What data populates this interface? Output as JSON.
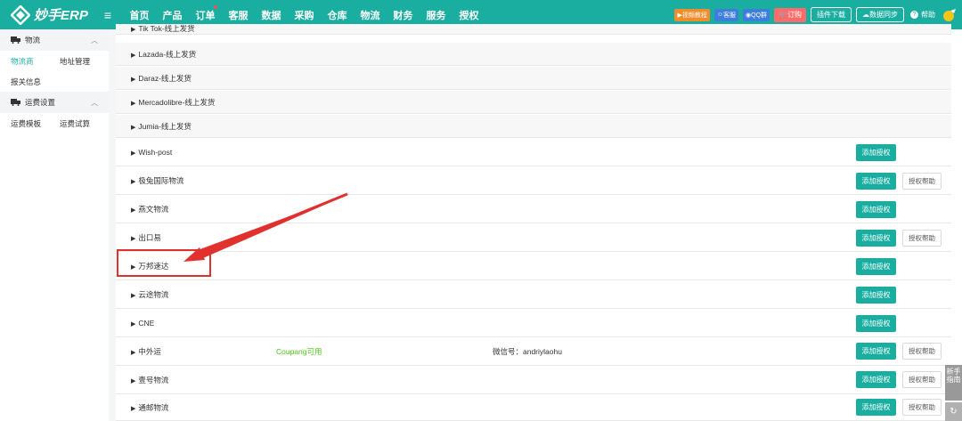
{
  "app": {
    "brand": "妙手ERP",
    "menu_icon": "hamburger-icon"
  },
  "nav": [
    "首页",
    "产品",
    "订单",
    "客服",
    "数据",
    "采购",
    "仓库",
    "物流",
    "财务",
    "服务",
    "授权"
  ],
  "tools": {
    "video_tutorial": "视频教程",
    "customer_service": "客服",
    "qq_group": "QQ群",
    "subscribe": "订购",
    "plugin_download": "插件下载",
    "data_sync": "数据同步",
    "help": "帮助"
  },
  "colors": {
    "brand": "#1aaea0",
    "highlight": "#e0312f"
  },
  "sidebar": {
    "logistics_group": "物流",
    "logistics_items": [
      "物流商",
      "地址管理"
    ],
    "customs": "报关信息",
    "freight_group": "运费设置",
    "freight_items": [
      "运费模板",
      "运费试算"
    ]
  },
  "rows": [
    {
      "name": "Tik Tok-线上发货",
      "add": null,
      "help": null,
      "note": null
    },
    {
      "name": "Lazada-线上发货",
      "add": null,
      "help": null,
      "note": null
    },
    {
      "name": "Daraz-线上发货",
      "add": null,
      "help": null,
      "note": null
    },
    {
      "name": "Mercadolibre-线上发货",
      "add": null,
      "help": null,
      "note": null
    },
    {
      "name": "Jumia-线上发货",
      "add": null,
      "help": null,
      "note": null
    },
    {
      "name": "Wish-post",
      "add": "添加授权",
      "help": null,
      "note": null
    },
    {
      "name": "极兔国际物流",
      "add": "添加授权",
      "help": "授权帮助",
      "note": null
    },
    {
      "name": "燕文物流",
      "add": "添加授权",
      "help": null,
      "note": null
    },
    {
      "name": "出口易",
      "add": "添加授权",
      "help": "授权帮助",
      "note": null
    },
    {
      "name": "万邦速达",
      "add": "添加授权",
      "help": null,
      "note": null
    },
    {
      "name": "云途物流",
      "add": "添加授权",
      "help": null,
      "note": null
    },
    {
      "name": "CNE",
      "add": "添加授权",
      "help": null,
      "note": null
    },
    {
      "name": "中外运",
      "add": "添加授权",
      "help": "授权帮助",
      "note": "Coupang可用",
      "wechat": "微信号：andriylaohu"
    },
    {
      "name": "壹号物流",
      "add": "添加授权",
      "help": "授权帮助",
      "note": null
    },
    {
      "name": "通邮物流",
      "add": "添加授权",
      "help": "授权帮助",
      "note": null
    }
  ],
  "float": {
    "guide": "新手指南",
    "refresh_icon": "refresh-icon"
  }
}
